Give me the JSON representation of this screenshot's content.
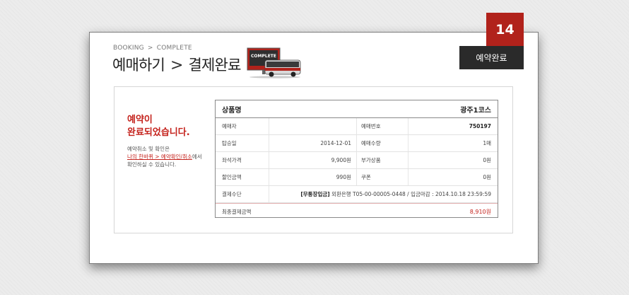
{
  "breadcrumb": {
    "step1": "BOOKING",
    "separator": ">",
    "step2": "COMPLETE"
  },
  "page_title": {
    "part1": "예매하기",
    "separator": ">",
    "part2": "결제완료"
  },
  "illustration": {
    "sign_text": "COMPLETE",
    "icon": "bus-complete-icon"
  },
  "badge": {
    "number": "14",
    "label": "예약완료"
  },
  "message": {
    "title_line1": "예약이",
    "title_line2": "완료되었습니다.",
    "text_line1": "예약취소 및 확인은",
    "link_text": "나의 한바퀴 > 예약확인/취소",
    "link_suffix": "에서",
    "text_line3": "확인하실 수 있습니다."
  },
  "table": {
    "header_label": "상품명",
    "header_value": "광주1코스",
    "rows": [
      {
        "label": "예매자",
        "value": "",
        "label2": "예매번호",
        "value2": "750197"
      },
      {
        "label": "탑승일",
        "value": "2014-12-01",
        "label2": "예매수량",
        "value2": "1매"
      },
      {
        "label": "좌석가격",
        "value": "9,900원",
        "label2": "부가상품",
        "value2": "0원"
      },
      {
        "label": "할인금액",
        "value": "990원",
        "label2": "쿠폰",
        "value2": "0원"
      }
    ],
    "payment": {
      "label": "결제수단",
      "method": "[무통장입금]",
      "detail": "외환은행 T05-00-00005-0448 / 입금마감 : 2014.10.18 23:59:59"
    },
    "final": {
      "label": "최종결제금액",
      "value": "8,910원"
    }
  },
  "colors": {
    "accent_red": "#c4221c",
    "badge_red": "#b1221b",
    "badge_dark": "#2a2a2a"
  }
}
